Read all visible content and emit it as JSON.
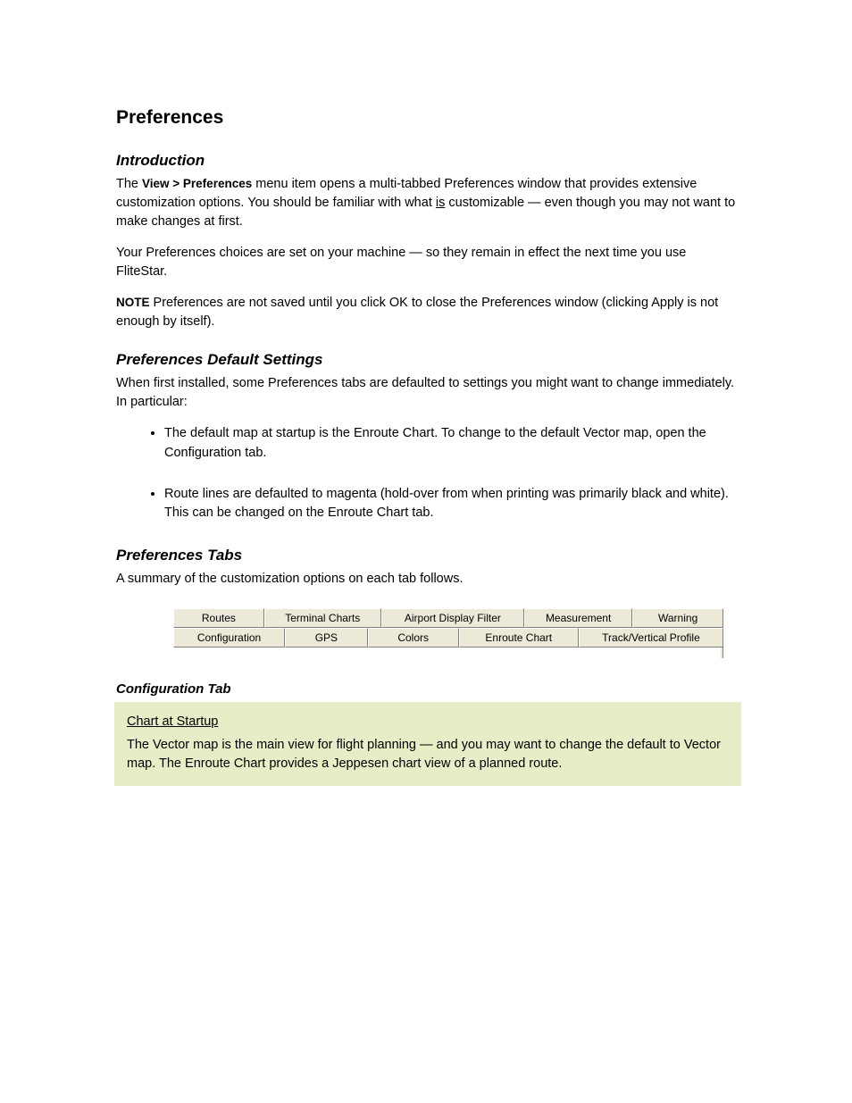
{
  "heading": "Preferences",
  "intro": {
    "subheading": "Introduction",
    "p1_a": "The ",
    "p1_b": "View > Preferences",
    "p1_c": " menu item opens a multi-tabbed Preferences window that provides extensive customization options. You should be familiar with what ",
    "p1_em": "is",
    "p1_d": " customizable — even though you may not want to make changes at first.",
    "p2": "Your Preferences choices are set on your machine — so they remain in effect the next time you use FliteStar.",
    "note_label": "NOTE",
    "note_body": " Preferences are not saved until you click OK to close the Preferences window (clicking Apply is not enough by itself)."
  },
  "defaults": {
    "subheading": "Preferences Default Settings",
    "intro": "When first installed, some Preferences tabs are defaulted to settings you might want to change immediately. In particular:",
    "bullets": [
      "The default map at startup is the Enroute Chart. To change to the default Vector map, open the Configuration tab.",
      "Route lines are defaulted to magenta (hold-over from when printing was primarily black and white). This can be changed on the Enroute Chart tab."
    ]
  },
  "tabs": {
    "subheading": "Preferences Tabs",
    "summary": "A summary of the customization options on each tab follows.",
    "row1": [
      "Routes",
      "Terminal Charts",
      "Airport Display Filter",
      "Measurement",
      "Warning"
    ],
    "row2": [
      "Configuration",
      "GPS",
      "Colors",
      "Enroute Chart",
      "Track/Vertical Profile"
    ]
  },
  "config": {
    "title": "Configuration Tab",
    "hb_title": "Chart at Startup",
    "hb_body": "The Vector map is the main view for flight planning — and you may want to change the default to Vector map. The Enroute Chart provides a Jeppesen chart view of a planned route."
  }
}
